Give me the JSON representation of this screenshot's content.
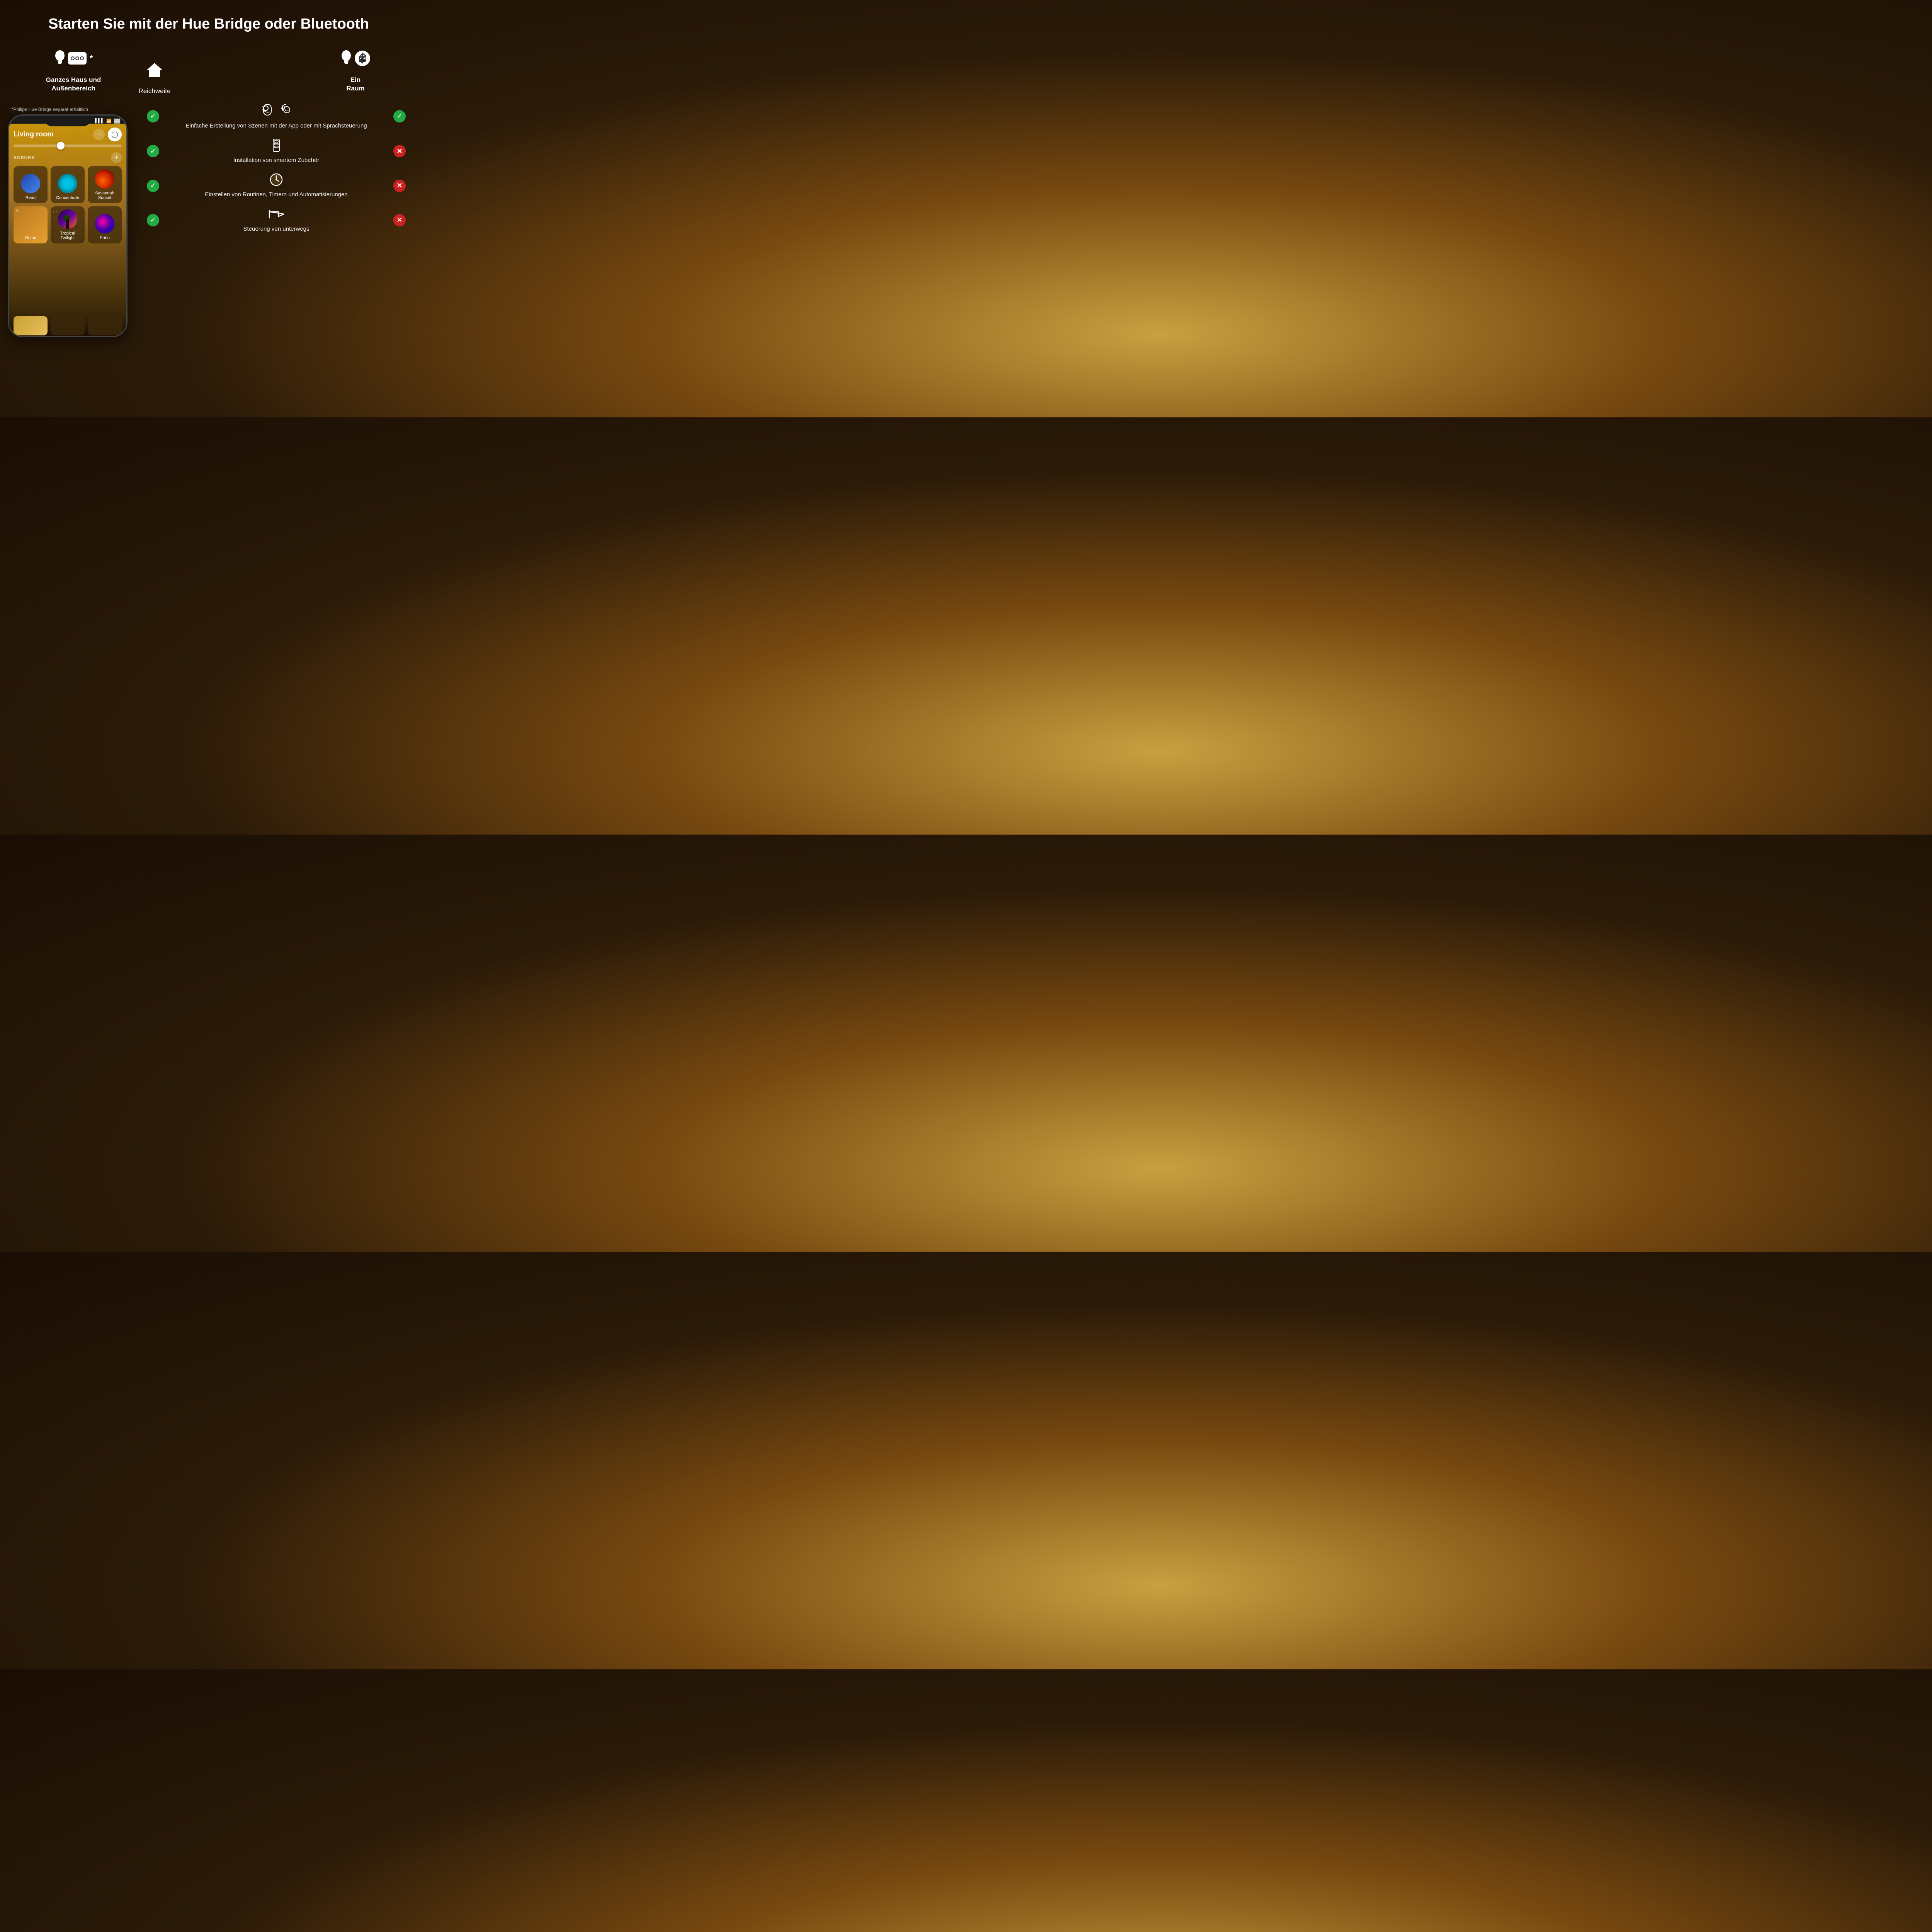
{
  "title": "Starten Sie mit der Hue Bridge oder Bluetooth",
  "bridge_column": {
    "label_line1": "Ganzes Haus und",
    "label_line2": "Außenbereich",
    "asterisk": "*"
  },
  "reach_column": {
    "label": "Reichweite"
  },
  "bluetooth_column": {
    "label_line1": "Ein",
    "label_line2": "Raum"
  },
  "footnote": "*Philips Hue Bridge separat erhältlich",
  "phone": {
    "room_name": "Living room",
    "scenes_label": "SCENES",
    "scenes": [
      {
        "name": "Read",
        "type": "gradient_blue"
      },
      {
        "name": "Concentrate",
        "type": "circle_cyan"
      },
      {
        "name": "Savannah Sunset",
        "type": "photo_sunset"
      },
      {
        "name": "Relax",
        "type": "gradient_warm"
      },
      {
        "name": "Tropical Twilight",
        "type": "photo_tropical"
      },
      {
        "name": "Soho",
        "type": "photo_soho"
      }
    ]
  },
  "features": [
    {
      "icon_type": "voice",
      "text": "Einfache Erstellung von Szenen mit der App oder mit Sprachsteuerung",
      "bridge_check": true,
      "bt_check": true
    },
    {
      "icon_type": "accessory",
      "text": "Installation von smartem Zubehör",
      "bridge_check": true,
      "bt_check": false
    },
    {
      "icon_type": "routine",
      "text": "Einstellen von Routinen, Timern und Automatisierungen",
      "bridge_check": true,
      "bt_check": false
    },
    {
      "icon_type": "remote",
      "text": "Steuerung von unterwegs",
      "bridge_check": true,
      "bt_check": false
    }
  ],
  "colors": {
    "check_green": "#22aa44",
    "x_red": "#cc2222",
    "background_dark": "#1a0e04",
    "background_mid": "#7a4a10"
  }
}
